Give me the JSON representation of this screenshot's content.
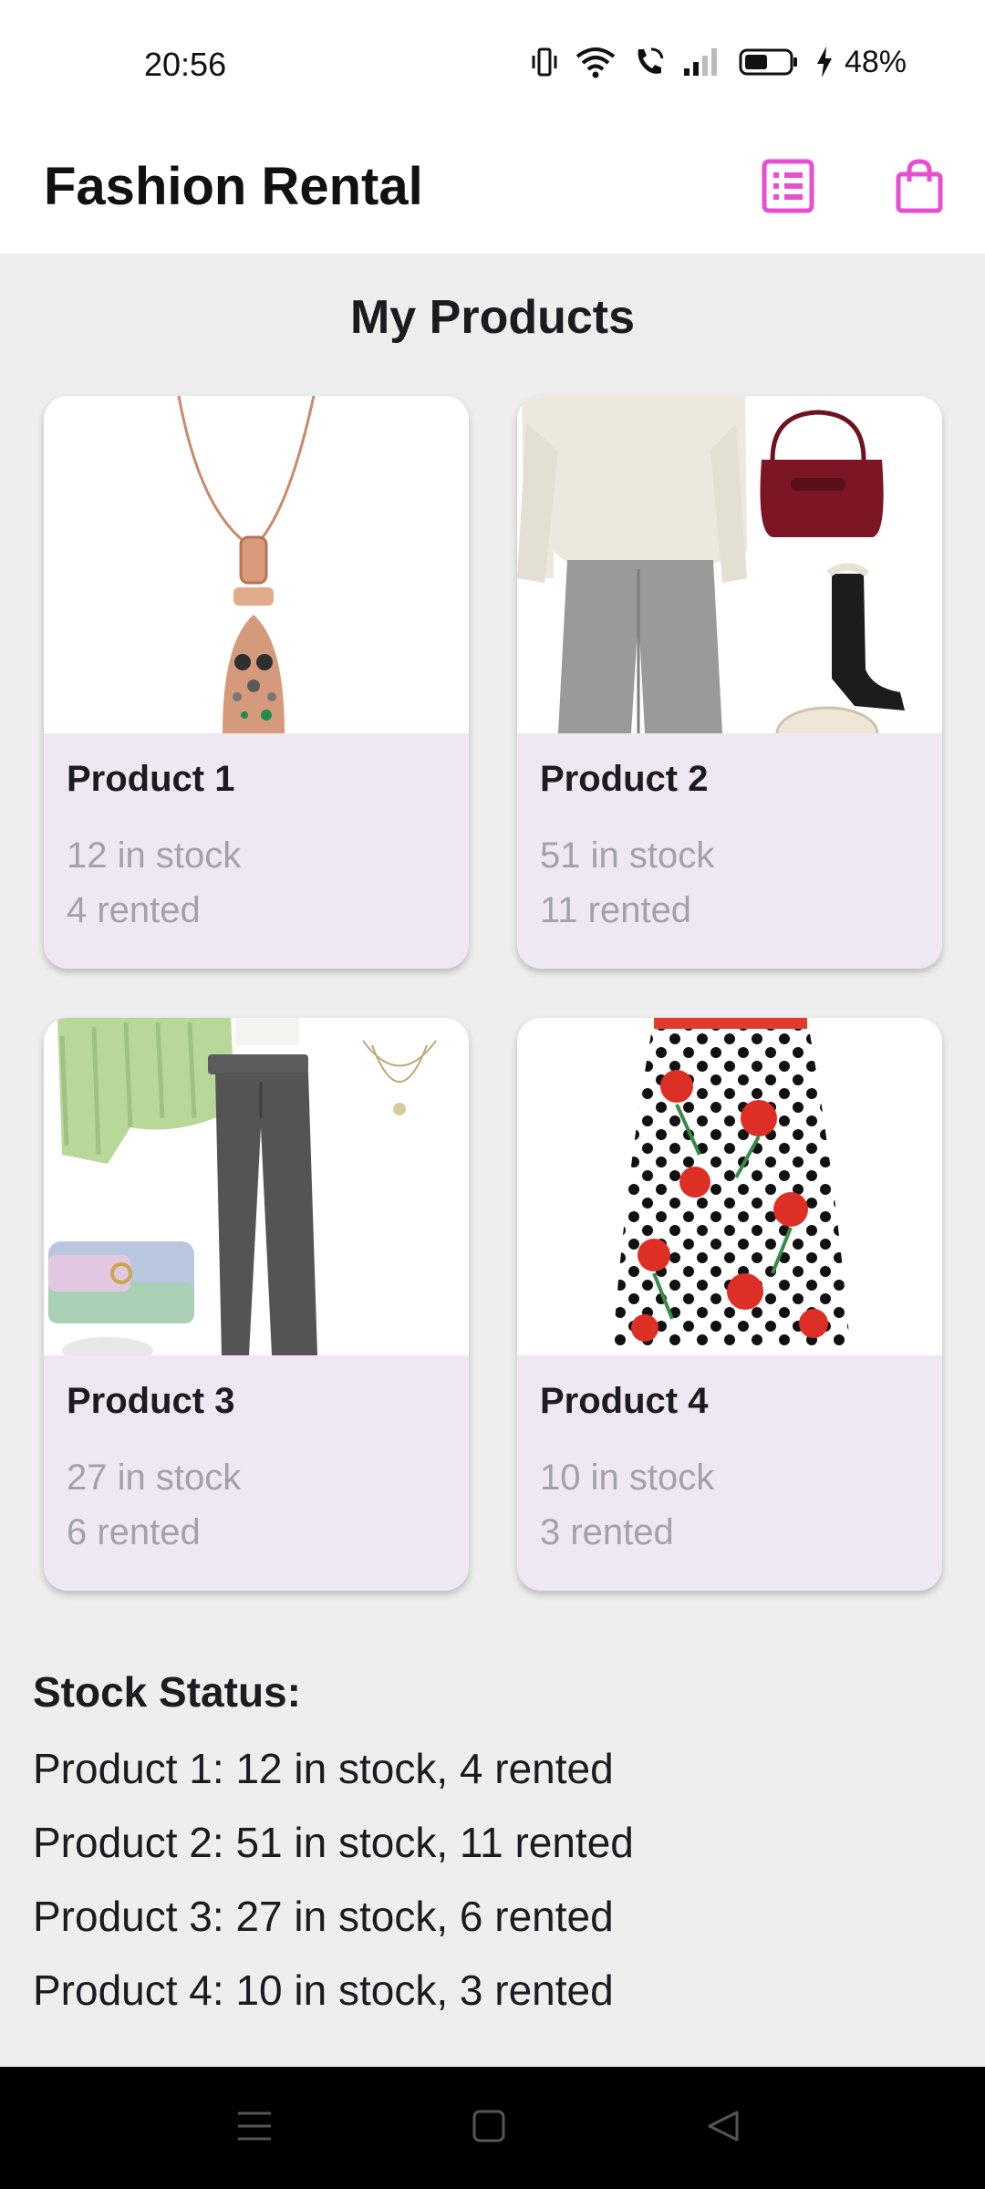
{
  "status_bar": {
    "time": "20:56",
    "battery": "48%",
    "icons": [
      "vibrate-icon",
      "wifi-icon",
      "wifi-call-icon",
      "signal-icon",
      "battery-icon",
      "charging-icon"
    ]
  },
  "app_bar": {
    "title": "Fashion Rental",
    "actions": [
      {
        "name": "list-icon",
        "color": "#e84fd0"
      },
      {
        "name": "shopping-bag-icon",
        "color": "#e84fd0"
      }
    ]
  },
  "main": {
    "section_title": "My Products",
    "products": [
      {
        "title": "Product 1",
        "stock": "12 in stock",
        "rented": "4 rented",
        "image": "necklace-image"
      },
      {
        "title": "Product 2",
        "stock": "51 in stock",
        "rented": "11 rented",
        "image": "outfit-sweater-trousers-image"
      },
      {
        "title": "Product 3",
        "stock": "27 in stock",
        "rented": "6 rented",
        "image": "outfit-green-knit-jeans-image"
      },
      {
        "title": "Product 4",
        "stock": "10 in stock",
        "rented": "3 rented",
        "image": "polka-dot-floral-skirt-image"
      }
    ],
    "stock_status": {
      "heading": "Stock Status:",
      "lines": [
        "Product 1: 12 in stock, 4 rented",
        "Product 2: 51 in stock, 11 rented",
        "Product 3: 27 in stock, 6 rented",
        "Product 4: 10 in stock, 3 rented"
      ]
    }
  },
  "nav_bar": {
    "buttons": [
      "menu-icon",
      "home-icon",
      "back-icon"
    ]
  },
  "colors": {
    "accent": "#e84fd0",
    "card_background": "#efe8f3",
    "page_background": "#eeeeee"
  }
}
